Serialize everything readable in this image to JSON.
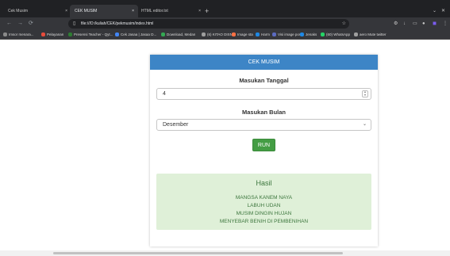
{
  "browser": {
    "tabs": [
      {
        "label": "Cek Musim",
        "close": "×",
        "active": false
      },
      {
        "label": "CEK MUSIM",
        "close": "×",
        "active": true
      },
      {
        "label": "HTML editor.txt",
        "close": "×",
        "active": false
      }
    ],
    "new_tab": "+",
    "window_controls": [
      "⌄",
      "✕"
    ],
    "nav": {
      "back": "←",
      "forward": "→",
      "reload": "⟳"
    },
    "url": "file:///D:/kuliah/CEK/pekmusim/index.html",
    "star": "☆",
    "extensions": [
      "⚙",
      "↓",
      "▭",
      "●",
      "◼",
      "⋮"
    ],
    "bookmarks": [
      {
        "label": "Imsor menara...",
        "color": "#8a8a8a"
      },
      {
        "label": "Pelayanan",
        "color": "#e74c3c"
      },
      {
        "label": "Presensi Teacher - Qyt...",
        "color": "#2e7d32"
      },
      {
        "label": "Cek Jasaa | Jasaa D...",
        "color": "#4285f4"
      },
      {
        "label": "Download, Medan",
        "color": "#34a853"
      },
      {
        "label": "(6) KITAO DISN",
        "color": "#9e9e9e"
      },
      {
        "label": "Image sta",
        "color": "#ff7043"
      },
      {
        "label": "Harm",
        "color": "#1e88e5"
      },
      {
        "label": "Visi image pos",
        "color": "#5c6bc0"
      },
      {
        "label": "Jenaks",
        "color": "#1e88e5"
      },
      {
        "label": "(60) WhatsApp",
        "color": "#25d366"
      },
      {
        "label": "aero Mute twitter",
        "color": "#9e9e9e"
      }
    ]
  },
  "app": {
    "header": "CEK MUSIM",
    "date_label": "Masukan Tanggal",
    "date_value": "4",
    "month_label": "Masukan Bulan",
    "month_value": "Desember",
    "run_label": "RUN",
    "result": {
      "title": "Hasil",
      "lines": [
        "MANGSA KANEM NAYA",
        "LABUH UDAN",
        "MUSIM DINGIN HUJAN",
        "MENYEBAR BENIH DI PEMBENIHAN"
      ]
    }
  }
}
